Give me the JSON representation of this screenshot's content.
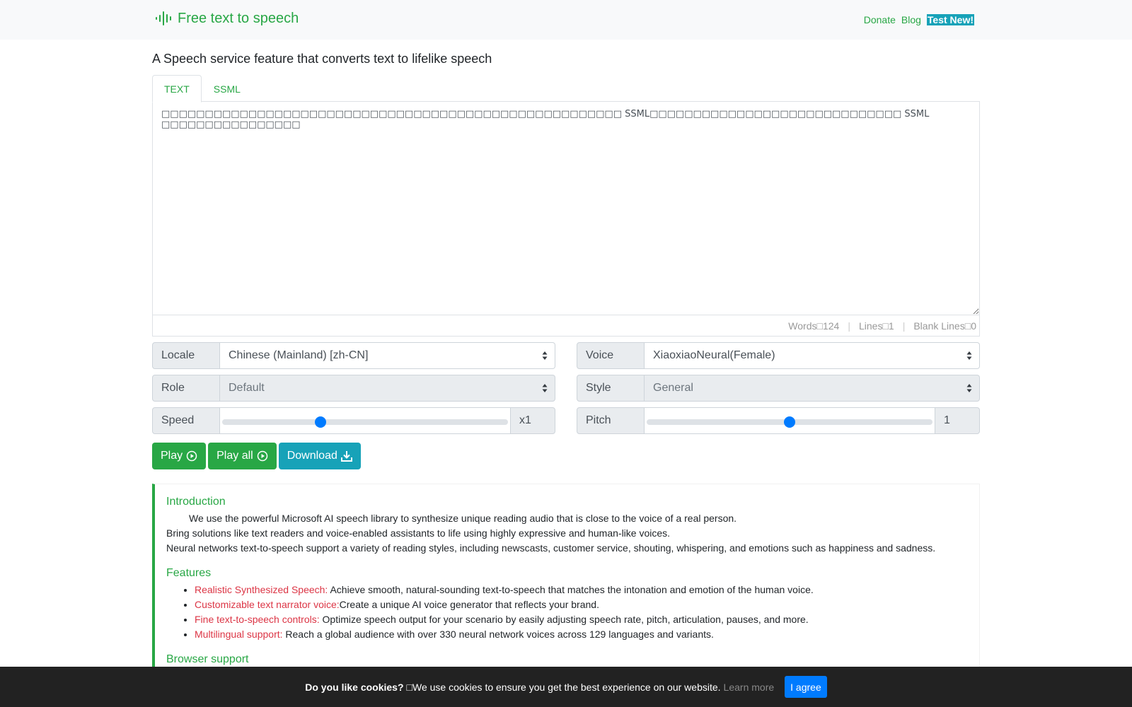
{
  "header": {
    "brand": "Free text to speech",
    "nav": [
      {
        "label": "Donate"
      },
      {
        "label": "Blog"
      },
      {
        "label": "Test New!"
      }
    ]
  },
  "subtitle": "A Speech service feature that converts text to lifelike speech",
  "tabs": [
    {
      "label": "TEXT",
      "active": true
    },
    {
      "label": "SSML",
      "active": false
    }
  ],
  "editor": {
    "text": "□□□□□□□□□□□□□□□□□□□□□□□□□□□□□□□□□□□□□□□□□□□□□□□□□□□□□ SSML□□□□□□□□□□□□□□□□□□□□□□□□□□□□□ SSML □□□□□□□□□□□□□□□□",
    "counts": {
      "words_label": "Words",
      "words_value": "124",
      "lines_label": "Lines",
      "lines_value": "1",
      "blank_label": "Blank Lines",
      "blank_value": "0",
      "label_separator": "□"
    }
  },
  "controls": {
    "locale": {
      "label": "Locale",
      "value": "Chinese (Mainland) [zh-CN]"
    },
    "voice": {
      "label": "Voice",
      "value": "XiaoxiaoNeural(Female)"
    },
    "role": {
      "label": "Role",
      "value": "Default",
      "disabled": true
    },
    "style": {
      "label": "Style",
      "value": "General",
      "disabled": true
    },
    "speed": {
      "label": "Speed",
      "value": "x1",
      "position": 0.34
    },
    "pitch": {
      "label": "Pitch",
      "value": "1",
      "position": 0.5
    }
  },
  "buttons": {
    "play": "Play",
    "play_all": "Play all",
    "download": "Download"
  },
  "info": {
    "intro": {
      "title": "Introduction",
      "lines": [
        "We use the powerful Microsoft AI speech library to synthesize unique reading audio that is close to the voice of a real person.",
        "Bring solutions like text readers and voice-enabled assistants to life using highly expressive and human-like voices.",
        "Neural networks text-to-speech support a variety of reading styles, including newscasts, customer service, shouting, whispering, and emotions such as happiness and sadness."
      ]
    },
    "features": {
      "title": "Features",
      "items": [
        {
          "highlight": "Realistic Synthesized Speech:",
          "text": " Achieve smooth, natural-sounding text-to-speech that matches the intonation and emotion of the human voice."
        },
        {
          "highlight": "Customizable text narrator voice:",
          "text": "Create a unique AI voice generator that reflects your brand."
        },
        {
          "highlight": "Fine text-to-speech controls:",
          "text": " Optimize speech output for your scenario by easily adjusting speech rate, pitch, articulation, pauses, and more."
        },
        {
          "highlight": "Multilingual support:",
          "text": " Reach a global audience with over 330 neural network voices across 129 languages and variants."
        }
      ]
    },
    "browser": {
      "title": "Browser support"
    }
  },
  "cookie": {
    "question": "Do you like cookies?",
    "icon_glyph": "□",
    "message": " We use cookies to ensure you get the best experience on our website.",
    "learn_more": "Learn more",
    "agree": "I agree"
  },
  "colors": {
    "brand": "#28a745",
    "info": "#17a2b8",
    "primary": "#007bff",
    "highlight": "#dc3545",
    "cookie_bar": "#222222"
  }
}
